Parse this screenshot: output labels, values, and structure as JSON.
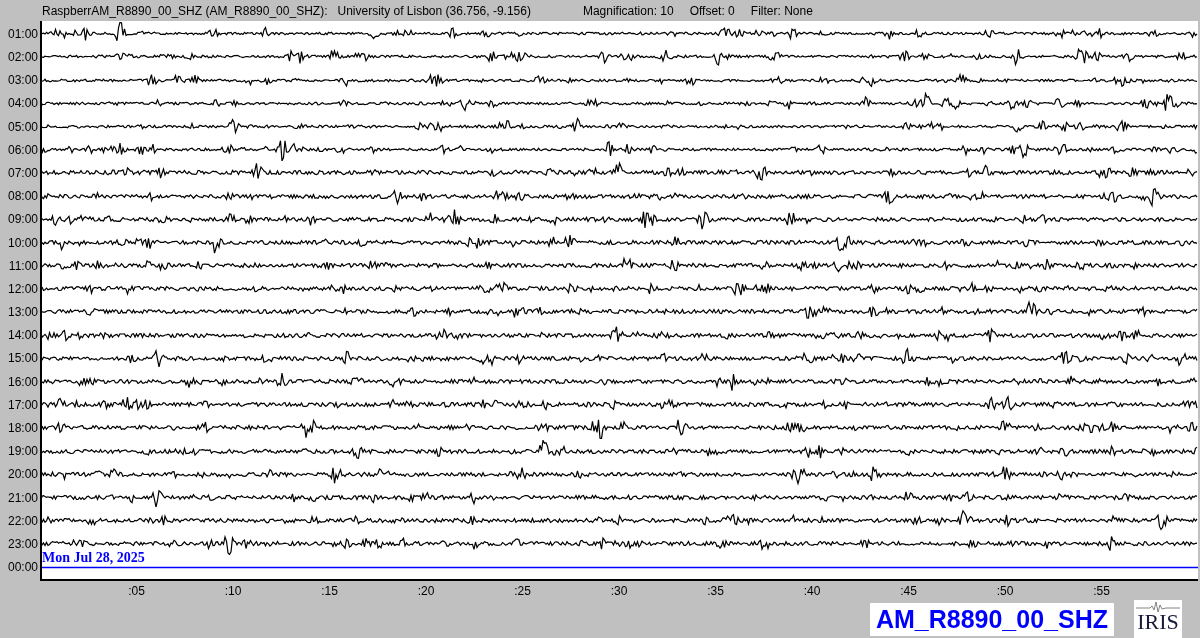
{
  "header": {
    "station": "RaspberrAM_R8890_00_SHZ (AM_R8890_00_SHZ):",
    "location": "University of Lisbon (36.756, -9.156)",
    "magnification": "Magnification: 10",
    "offset": "Offset: 0",
    "filter": "Filter: None"
  },
  "rows": [
    {
      "kind": "trace",
      "time": "01:00"
    },
    {
      "kind": "trace",
      "time": "02:00"
    },
    {
      "kind": "trace",
      "time": "03:00"
    },
    {
      "kind": "trace",
      "time": "04:00"
    },
    {
      "kind": "trace",
      "time": "05:00"
    },
    {
      "kind": "trace",
      "time": "06:00"
    },
    {
      "kind": "trace",
      "time": "07:00"
    },
    {
      "kind": "trace",
      "time": "08:00"
    },
    {
      "kind": "trace",
      "time": "09:00"
    },
    {
      "kind": "trace",
      "time": "10:00"
    },
    {
      "kind": "trace",
      "time": "11:00"
    },
    {
      "kind": "trace",
      "time": "12:00"
    },
    {
      "kind": "trace",
      "time": "13:00"
    },
    {
      "kind": "trace",
      "time": "14:00"
    },
    {
      "kind": "trace",
      "time": "15:00"
    },
    {
      "kind": "trace",
      "time": "16:00"
    },
    {
      "kind": "trace",
      "time": "17:00"
    },
    {
      "kind": "trace",
      "time": "18:00"
    },
    {
      "kind": "trace",
      "time": "19:00"
    },
    {
      "kind": "trace",
      "time": "20:00"
    },
    {
      "kind": "trace",
      "time": "21:00"
    },
    {
      "kind": "trace",
      "time": "22:00"
    },
    {
      "kind": "trace",
      "time": "23:00"
    },
    {
      "kind": "day_marker",
      "time": "00:00",
      "date": "Mon Jul 28, 2025"
    }
  ],
  "axis_ticks": [
    ":05",
    ":10",
    ":15",
    ":20",
    ":25",
    ":30",
    ":35",
    ":40",
    ":45",
    ":50",
    ":55"
  ],
  "station_label": "AM_R8890_00_SHZ",
  "logo_text": "IRIS"
}
